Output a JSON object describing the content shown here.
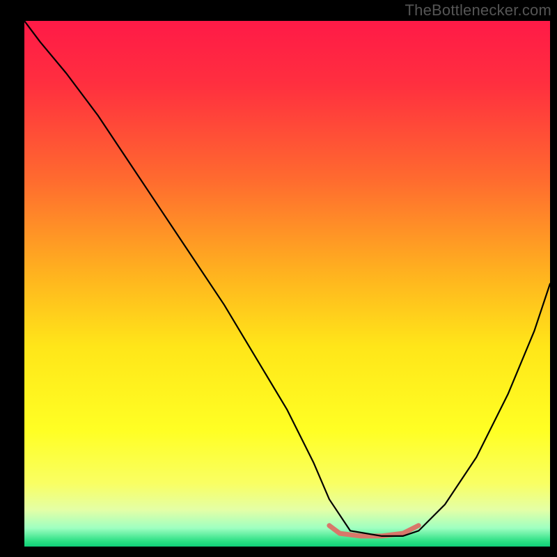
{
  "watermark": "TheBottlenecker.com",
  "chart_data": {
    "type": "line",
    "title": "",
    "xlabel": "",
    "ylabel": "",
    "xlim": [
      0,
      100
    ],
    "ylim": [
      0,
      100
    ],
    "grid": false,
    "legend": false,
    "background_gradient": {
      "stops": [
        {
          "offset": 0.0,
          "color": "#ff1a47"
        },
        {
          "offset": 0.12,
          "color": "#ff2f3f"
        },
        {
          "offset": 0.3,
          "color": "#ff6a2f"
        },
        {
          "offset": 0.48,
          "color": "#ffb21f"
        },
        {
          "offset": 0.62,
          "color": "#ffe619"
        },
        {
          "offset": 0.78,
          "color": "#ffff24"
        },
        {
          "offset": 0.88,
          "color": "#f9ff63"
        },
        {
          "offset": 0.93,
          "color": "#e4ffa6"
        },
        {
          "offset": 0.965,
          "color": "#9effc1"
        },
        {
          "offset": 0.99,
          "color": "#2bdf84"
        },
        {
          "offset": 1.0,
          "color": "#0fce79"
        }
      ]
    },
    "series": [
      {
        "name": "bottleneck-curve",
        "color": "#000000",
        "width": 2.2,
        "x": [
          0,
          3,
          8,
          14,
          20,
          26,
          32,
          38,
          44,
          50,
          55,
          58,
          62,
          68,
          72,
          75,
          80,
          86,
          92,
          97,
          100
        ],
        "values": [
          100,
          96,
          90,
          82,
          73,
          64,
          55,
          46,
          36,
          26,
          16,
          9,
          3,
          2,
          2,
          3,
          8,
          17,
          29,
          41,
          50
        ]
      }
    ],
    "highlight_segment": {
      "color": "#d8776a",
      "width": 7,
      "x": [
        58,
        60,
        64,
        68,
        72,
        75
      ],
      "values": [
        4,
        2.5,
        2,
        2,
        2.5,
        4
      ]
    }
  }
}
